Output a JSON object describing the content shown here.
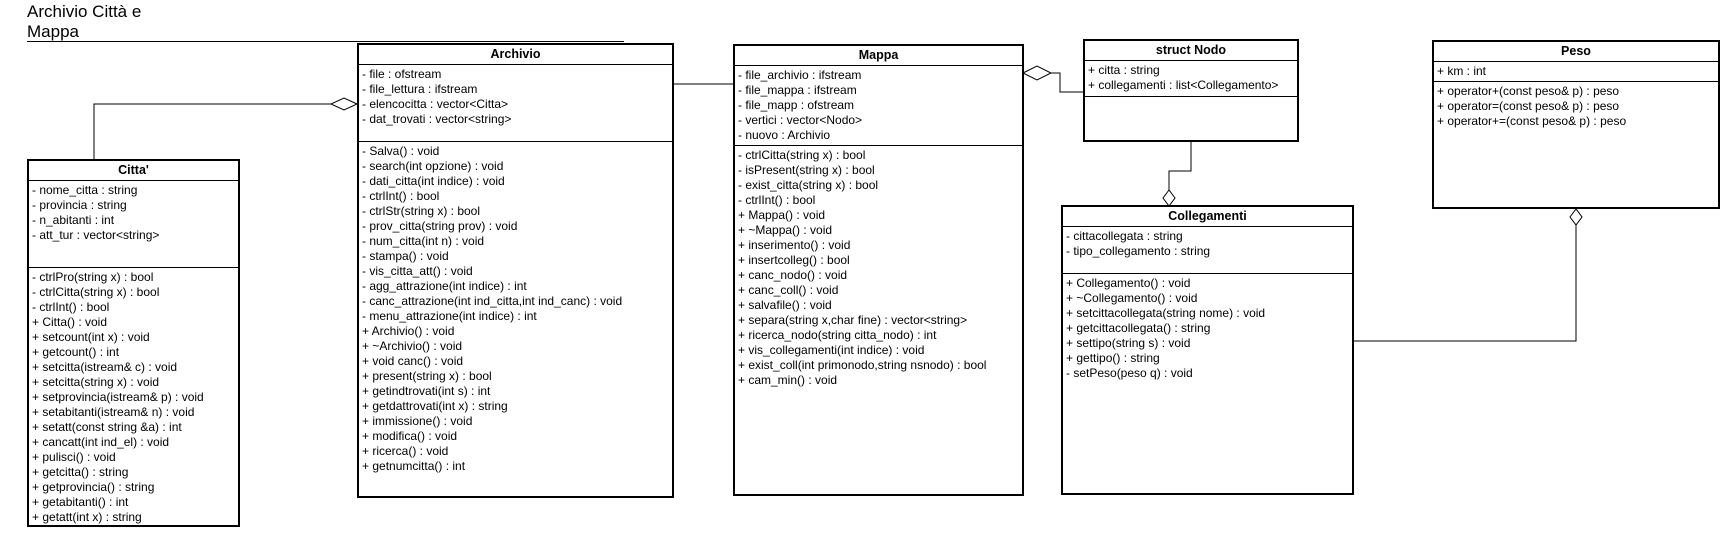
{
  "diagram": {
    "title": "Archivio Città e Mappa",
    "classes": {
      "citta": {
        "name": "Citta'",
        "attributes": [
          "- nome_citta : string",
          "- provincia : string",
          "- n_abitanti : int",
          "- att_tur : vector<string>"
        ],
        "methods": [
          "- ctrlPro(string x) : bool",
          "- ctrlCitta(string x) : bool",
          "-  ctrlInt() : bool",
          "+ Citta() : void",
          "+ setcount(int x) : void",
          "+ getcount() : int",
          "+ setcitta(istream& c) : void",
          "+ setcitta(string x) : void",
          "+ setprovincia(istream& p) : void",
          "+ setabitanti(istream& n) : void",
          "+ setatt(const string &a) : int",
          "+ cancatt(int ind_el) : void",
          "+ pulisci() : void",
          "+ getcitta() : string",
          "+ getprovincia() : string",
          "+ getabitanti() : int",
          "+ getatt(int x) : string"
        ]
      },
      "archivio": {
        "name": "Archivio",
        "attributes": [
          "- file : ofstream",
          "- file_lettura : ifstream",
          "- elencocitta : vector<Citta>",
          "- dat_trovati : vector<string>"
        ],
        "methods": [
          "- Salva() : void",
          "- search(int opzione) : void",
          "- dati_citta(int indice) : void",
          "- ctrlInt() : bool",
          "- ctrlStr(string x) : bool",
          "- prov_citta(string prov) : void",
          "- num_citta(int n) : void",
          "- stampa() : void",
          "- vis_citta_att() : void",
          "- agg_attrazione(int indice) : int",
          "- canc_attrazione(int ind_citta,int ind_canc) : void",
          "- menu_attrazione(int indice) : int",
          "+ Archivio() : void",
          "+ ~Archivio() : void",
          "+ void canc() : void",
          "+ present(string x) : bool",
          "+ getindtrovati(int s) : int",
          "+ getdattrovati(int x) : string",
          "+ immissione() : void",
          "+ modifica() : void",
          "+ ricerca() : void",
          "+ getnumcitta() : int"
        ]
      },
      "mappa": {
        "name": "Mappa",
        "attributes": [
          "- file_archivio : ifstream",
          "- file_mappa : ifstream",
          "- file_mapp : ofstream",
          "- vertici : vector<Nodo>",
          "- nuovo : Archivio"
        ],
        "methods": [
          "- ctrlCitta(string x) : bool",
          "- isPresent(string x) : bool",
          "- exist_citta(string x) : bool",
          "- ctrlInt() : bool",
          "+ Mappa() : void",
          "+ ~Mappa() : void",
          "+ inserimento() : void",
          "+ insertcolleg() : bool",
          "+ canc_nodo() : void",
          "+ canc_coll() : void",
          "+ salvafile() : void",
          "+ separa(string x,char fine) : vector<string>",
          "+ ricerca_nodo(string citta_nodo) : int",
          "+ vis_collegamenti(int indice) : void",
          "+ exist_coll(int primonodo,string nsnodo) : bool",
          "+ cam_min() : void"
        ]
      },
      "nodo": {
        "name": "struct Nodo",
        "attributes": [
          "+ citta : string",
          "+ collegamenti : list<Collegamento>"
        ],
        "methods": []
      },
      "collegamenti": {
        "name": "Collegamenti",
        "attributes": [
          "-  cittacollegata : string",
          "- tipo_collegamento : string"
        ],
        "methods": [
          "+ Collegamento() : void",
          "+ ~Collegamento() : void",
          "+ setcittacollegata(string nome) : void",
          "+ getcittacollegata() : string",
          "+ settipo(string s) : void",
          "+ gettipo() : string",
          "- setPeso(peso q) : void"
        ]
      },
      "peso": {
        "name": "Peso",
        "attributes": [
          "+ km : int"
        ],
        "methods": [
          "+ operator+(const peso& p) : peso",
          "+ operator=(const peso& p) : peso",
          "+ operator+=(const peso& p) : peso"
        ]
      }
    }
  }
}
